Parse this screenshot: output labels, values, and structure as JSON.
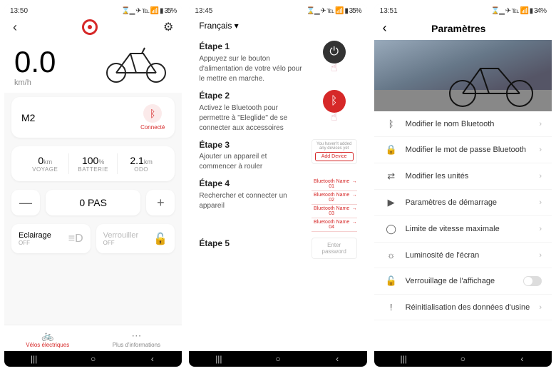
{
  "screen1": {
    "status": {
      "time": "13:50",
      "battery": "35%",
      "icons": "⌛▁ ✈ ℡ 📶 ▮"
    },
    "speed": "0.0",
    "speed_unit": "km/h",
    "model": "M2",
    "conn_status": "Connecté",
    "stats": [
      {
        "value": "0",
        "unit": "km",
        "label": "VOYAGE"
      },
      {
        "value": "100",
        "unit": "%",
        "label": "BATTERIE"
      },
      {
        "value": "2.1",
        "unit": "km",
        "label": "ODO"
      }
    ],
    "pas_minus": "—",
    "pas_label": "0 PAS",
    "pas_plus": "+",
    "toggles": [
      {
        "title": "Eclairage",
        "state": "OFF"
      },
      {
        "title": "Verrouiller",
        "state": "OFF"
      }
    ],
    "tabs": [
      {
        "icon": "🚲",
        "label": "Vélos électriques"
      },
      {
        "icon": "⋯",
        "label": "Plus d'informations"
      }
    ]
  },
  "screen2": {
    "status": {
      "time": "13:45",
      "battery": "35%",
      "icons": "⌛▁ ✈ ℡ 📶 ▮"
    },
    "language": "Français ▾",
    "steps": [
      {
        "title": "Étape 1",
        "body": "Appuyez sur le bouton d'alimentation de votre vélo pour le mettre en marche."
      },
      {
        "title": "Étape 2",
        "body": "Activez le Bluetooth pour permettre à \"Eleglide\" de se connecter aux accessoires"
      },
      {
        "title": "Étape 3",
        "body": "Ajouter un appareil et commencer à rouler"
      },
      {
        "title": "Étape 4",
        "body": "Rechercher et connecter un appareil"
      },
      {
        "title": "Étape 5",
        "body": ""
      }
    ],
    "add_device_hint": "You haven't added any devices yet",
    "add_device_btn": "Add Device",
    "bt_names": [
      "Bluetooth Name 01",
      "Bluetooth Name 02",
      "Bluetooth Name 03",
      "Bluetooth Name 04"
    ],
    "enter_pw": "Enter password"
  },
  "screen3": {
    "status": {
      "time": "13:51",
      "battery": "34%",
      "icons": "⌛▁ ✈ ℡ 📶 ▮"
    },
    "title": "Paramètres",
    "items": [
      {
        "icon": "bluetooth",
        "glyph": "ᛒ",
        "label": "Modifier le nom Bluetooth",
        "tail": "chevron"
      },
      {
        "icon": "lock",
        "glyph": "🔒",
        "label": "Modifier le mot de passe Bluetooth",
        "tail": "chevron"
      },
      {
        "icon": "units",
        "glyph": "⇄",
        "label": "Modifier les unités",
        "tail": "chevron"
      },
      {
        "icon": "startup",
        "glyph": "▶",
        "label": "Paramètres de démarrage",
        "tail": "chevron"
      },
      {
        "icon": "speed",
        "glyph": "◯",
        "label": "Limite de vitesse maximale",
        "tail": "chevron"
      },
      {
        "icon": "brightness",
        "glyph": "☼",
        "label": "Luminosité de l'écran",
        "tail": "chevron"
      },
      {
        "icon": "display-lock",
        "glyph": "🔓",
        "label": "Verrouillage de l'affichage",
        "tail": "switch"
      },
      {
        "icon": "reset",
        "glyph": "!",
        "label": "Réinitialisation des données d'usine",
        "tail": "chevron"
      }
    ]
  }
}
